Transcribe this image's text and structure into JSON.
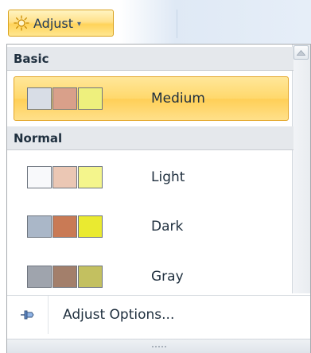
{
  "adjust_button": {
    "label": "Adjust",
    "icon": "sun-icon",
    "arrow": "▾"
  },
  "sections": {
    "basic": {
      "title": "Basic"
    },
    "normal": {
      "title": "Normal"
    }
  },
  "items": {
    "medium": {
      "label": "Medium",
      "selected": true,
      "swatches": [
        "#d8dde6",
        "#d9a08a",
        "#eef07d"
      ]
    },
    "light": {
      "label": "Light",
      "selected": false,
      "swatches": [
        "#f8f9fb",
        "#ebc7b4",
        "#f4f58c"
      ]
    },
    "dark": {
      "label": "Dark",
      "selected": false,
      "swatches": [
        "#aab7c8",
        "#c97a55",
        "#eaea30"
      ]
    },
    "gray": {
      "label": "Gray",
      "selected": false,
      "swatches": [
        "#9fa4ad",
        "#a37f6b",
        "#c3c060"
      ]
    }
  },
  "footer": {
    "options_label": "Adjust Options...",
    "options_icon": "push-pin-icon"
  },
  "scrollbar": {
    "up_icon": "scroll-up-icon"
  },
  "colors": {
    "selected_fill": "#ffd86b",
    "selected_border": "#e3a628",
    "header_fill": "#e5e8ec",
    "text": "#20303f"
  }
}
